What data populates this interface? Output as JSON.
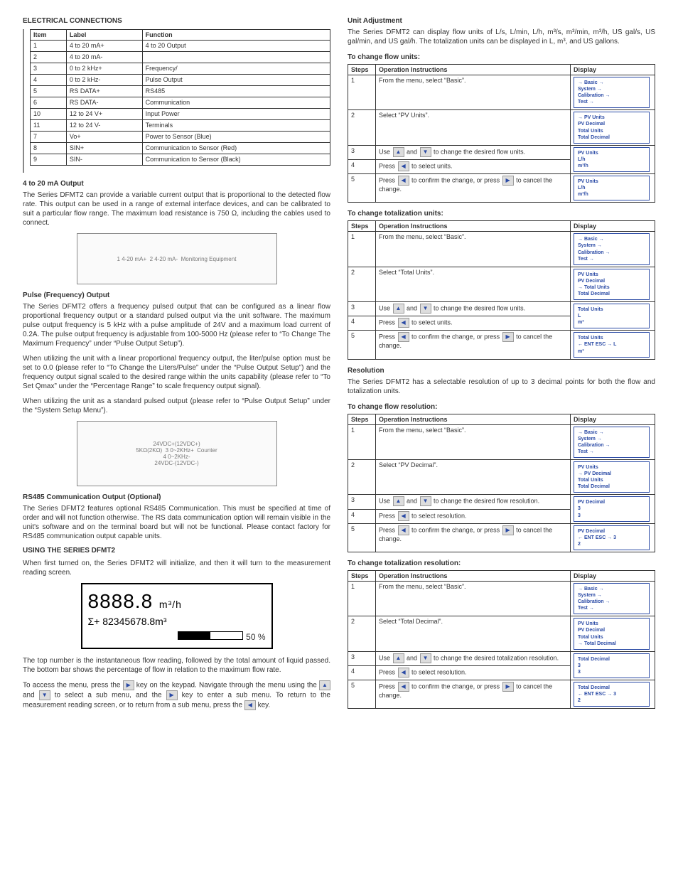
{
  "left": {
    "sec1_title": "ELECTRICAL CONNECTIONS",
    "elec_table": {
      "headers": [
        "Item",
        "Label",
        "Function"
      ],
      "rows": [
        [
          "1",
          "4 to 20 mA+",
          "4 to 20 Output"
        ],
        [
          "2",
          "4 to 20 mA-",
          ""
        ],
        [
          "3",
          "0 to 2 kHz+",
          "Frequency/"
        ],
        [
          "4",
          "0 to 2 kHz-",
          "Pulse Output"
        ],
        [
          "5",
          "RS DATA+",
          "RS485"
        ],
        [
          "6",
          "RS DATA-",
          "Communication"
        ],
        [
          "10",
          "12 to 24 V+",
          "Input Power"
        ],
        [
          "11",
          "12 to 24 V-",
          "Terminals"
        ],
        [
          "7",
          "Vo+",
          "Power to Sensor (Blue)"
        ],
        [
          "8",
          "SIN+",
          "Communication to Sensor (Red)"
        ],
        [
          "9",
          "SIN-",
          "Communication to Sensor (Black)"
        ]
      ]
    },
    "sub1": "4 to 20 mA Output",
    "p1": "The Series DFMT2 can provide a variable current output that is proportional to the detected flow rate. This output can be used in a range of external interface devices, and can be calibrated to suit a particular flow range. The maximum load resistance is 750 Ω, including the cables used to connect.",
    "dia1_labels": [
      "1  4-20 mA+",
      "2  4-20 mA-",
      "Monitoring Equipment"
    ],
    "sub2": "Pulse (Frequency) Output",
    "p2": "The Series DFMT2 offers a frequency pulsed output that can be configured as a linear flow proportional frequency output or a standard pulsed output via the unit software. The maximum pulse output frequency is 5 kHz with a pulse amplitude of 24V and a maximum load current of 0.2A. The pulse output frequency is adjustable from 100-5000 Hz (please refer to “To Change The Maximum Frequency” under “Pulse Output Setup”).",
    "p3": "When utilizing the unit with a linear proportional frequency output, the liter/pulse option must be set to 0.0 (please refer to “To Change the Liters/Pulse” under the “Pulse Output Setup”) and the frequency output signal scaled to the desired range within the units capability (please refer to “To Set Qmax” under the “Percentage Range” to scale frequency output signal).",
    "p4": "When utilizing the unit as a standard pulsed output (please refer to “Pulse Output Setup” under the “System Setup Menu”).",
    "dia2_labels": [
      "24VDC+(12VDC+)",
      "5KΩ(2KΩ)",
      "3  0~2KHz+",
      "4  0~2KHz-",
      "Counter",
      "24VDC-(12VDC-)"
    ],
    "sub3": "RS485 Communication Output (Optional)",
    "p5": "The Series DFMT2 features optional RS485 Communication. This must be specified at time of order and will not function otherwise. The RS data communication option will remain visible in the unit's software and on the terminal board but will not be functional. Please contact factory for RS485 communication output capable units.",
    "sec2_title": "USING THE SERIES DFMT2",
    "p6": "When first turned on, the Series DFMT2 will initialize, and then it will turn to the measurement reading screen.",
    "lcd": {
      "main": "8888.8",
      "main_unit": "m³/h",
      "sub": "Σ+ 82345678.8m³",
      "bar_pct": "50 %"
    },
    "p7": "The top number is the instantaneous flow reading, followed by the total amount of liquid passed. The bottom bar shows the percentage of flow in relation to the maximum flow rate.",
    "p8a": "To access the menu, press the ",
    "p8b": " key on the keypad. Navigate through the menu using the ",
    "p8c": " and ",
    "p8d": " to select a sub menu, and the ",
    "p8e": " key to enter a sub menu. To return to the measurement reading screen, or to return from a sub menu, press the ",
    "p8f": " key."
  },
  "right": {
    "sub1": "Unit Adjustment",
    "p1": "The Series DFMT2 can display flow units of L/s, L/min, L/h, m³/s, m³/min, m³/h, US gal/s, US gal/min, and US gal/h. The totalization units can be displayed in L, m³, and US gallons.",
    "sub2": "To change flow units:",
    "table_headers": [
      "Steps",
      "Operation Instructions",
      "Display"
    ],
    "flow_units": {
      "rows": [
        {
          "step": "1",
          "instr": "From the menu, select “Basic”.",
          "disp": [
            "→ Basic →",
            "System →",
            "Calibration →",
            "Test →"
          ]
        },
        {
          "step": "2",
          "instr": "Select “PV Units”.",
          "disp": [
            "→ PV Units",
            "PV Decimal",
            "Total Units",
            "Total Decimal"
          ]
        },
        {
          "step": "3",
          "instr_pre": "Use ",
          "instr_mid": " and ",
          "instr_post": " to change the desired flow units.",
          "disp": [
            "PV Units",
            "        L/h",
            "        m³/h"
          ]
        },
        {
          "step": "4",
          "instr_pre": "Press ",
          "instr_post": " to select units.",
          "disp_shared": true
        },
        {
          "step": "5",
          "instr_pre": "Press ",
          "instr_mid": " to confirm the change, or press ",
          "instr_post": " to cancel the change.",
          "disp": [
            "PV Units",
            "        L/h",
            "        m³/h"
          ]
        }
      ]
    },
    "sub3": "To change totalization units:",
    "total_units": {
      "rows": [
        {
          "step": "1",
          "instr": "From the menu, select “Basic”.",
          "disp": [
            "→ Basic →",
            "System →",
            "Calibration →",
            "Test →"
          ]
        },
        {
          "step": "2",
          "instr": "Select “Total Units”.",
          "disp": [
            "PV Units",
            "PV Decimal",
            "→ Total Units",
            "Total Decimal"
          ]
        },
        {
          "step": "3",
          "instr_pre": "Use ",
          "instr_mid": " and ",
          "instr_post": " to change the desired flow units.",
          "disp": [
            "Total Units",
            "        L",
            "        m³"
          ]
        },
        {
          "step": "4",
          "instr_pre": "Press ",
          "instr_post": " to select units.",
          "disp_shared": true
        },
        {
          "step": "5",
          "instr_pre": "Press ",
          "instr_mid": " to confirm the change, or press ",
          "instr_post": " to cancel the change.",
          "disp": [
            "Total Units",
            "← ENT ESC →   L",
            "        m³"
          ]
        }
      ]
    },
    "sub4": "Resolution",
    "p2": "The Series DFMT2 has a selectable resolution of up to 3 decimal points for both the flow and totalization units.",
    "sub5": "To change flow resolution:",
    "flow_res": {
      "rows": [
        {
          "step": "1",
          "instr": "From the menu, select “Basic”.",
          "disp": [
            "→ Basic →",
            "System →",
            "Calibration →",
            "Test →"
          ]
        },
        {
          "step": "2",
          "instr": "Select “PV Decimal”.",
          "disp": [
            "PV Units",
            "→ PV Decimal",
            "Total Units",
            "Total Decimal"
          ]
        },
        {
          "step": "3",
          "instr_pre": "Use ",
          "instr_mid": " and ",
          "instr_post": " to change the desired flow resolution.",
          "disp": [
            "PV Decimal",
            "        3",
            "        3"
          ]
        },
        {
          "step": "4",
          "instr_pre": "Press ",
          "instr_post": " to select resolution.",
          "disp_shared": true
        },
        {
          "step": "5",
          "instr_pre": "Press ",
          "instr_mid": " to confirm the change, or press ",
          "instr_post": " to cancel the change.",
          "disp": [
            "PV Decimal",
            "← ENT ESC →   3",
            "        2"
          ]
        }
      ]
    },
    "sub6": "To change totalization resolution:",
    "total_res": {
      "rows": [
        {
          "step": "1",
          "instr": "From the menu, select “Basic”.",
          "disp": [
            "→ Basic →",
            "System →",
            "Calibration →",
            "Test →"
          ]
        },
        {
          "step": "2",
          "instr": "Select “Total Decimal”.",
          "disp": [
            "PV Units",
            "PV Decimal",
            "Total Units",
            "→ Total Decimal"
          ]
        },
        {
          "step": "3",
          "instr_pre": "Use ",
          "instr_mid": " and ",
          "instr_post": " to change the desired totalization resolution.",
          "disp": [
            "Total Decimal",
            "        3",
            "        3"
          ]
        },
        {
          "step": "4",
          "instr_pre": "Press ",
          "instr_post": " to select resolution.",
          "disp_shared": true
        },
        {
          "step": "5",
          "instr_pre": "Press ",
          "instr_mid": " to confirm the change, or press ",
          "instr_post": " to cancel the change.",
          "disp": [
            "Total Decimal",
            "← ENT ESC →   3",
            "        2"
          ]
        }
      ]
    }
  }
}
